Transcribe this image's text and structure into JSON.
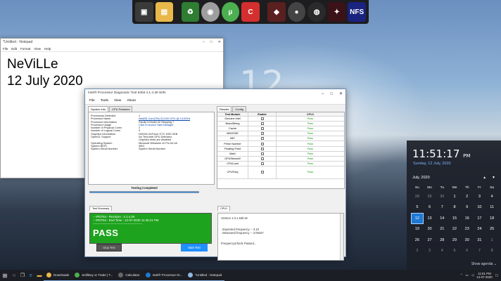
{
  "notepad": {
    "title": "*Untitled - Notepad",
    "menu": [
      "File",
      "Edit",
      "Format",
      "View",
      "Help"
    ],
    "lines": [
      "NeViLLe",
      "12 July 2020"
    ]
  },
  "desktop": {
    "ghost_text": "12"
  },
  "diagnostic": {
    "title": "Intel® Processor Diagnostic Tool 64bit 4.1.4.36 WIN",
    "menu": [
      "File",
      "Tools",
      "View",
      "About"
    ],
    "tabs": [
      "System Info",
      "CPU Features"
    ],
    "system_info": [
      {
        "k": "Processors Detected",
        "v": "1"
      },
      {
        "k": "Processor Name",
        "v": "Intel(R) Core(TM) i3-2100 CPU @ 3.10GHz",
        "link": true
      },
      {
        "k": "Processor Information",
        "v": "Family 6 Model 42 Stepping 7"
      },
      {
        "k": "Processor Usage",
        "v": "Click to launch Task Manager",
        "link": true
      },
      {
        "k": "Number of Physical Cores",
        "v": "2"
      },
      {
        "k": "Number of Logical Cores",
        "v": "4"
      },
      {
        "k": "Graphics Information",
        "v": "NVIDIA GeForce GTX 1050 3GB"
      },
      {
        "k": "OpenGL Support",
        "v": "No Test-Intel GPU Detected"
      },
      {
        "k": "",
        "v": "Graphics tests are disabled"
      },
      {
        "k": "Operating System",
        "v": "Microsoft Windows 10 Pro 64-bit"
      },
      {
        "k": "System BIOS",
        "v": "4601"
      },
      {
        "k": "System Serial Number",
        "v": "System Serial Number"
      }
    ],
    "results_tabs": [
      "Results",
      "Config"
    ],
    "results_header": {
      "module": "Test Module",
      "enable": "Enable",
      "cpu": "CPU1"
    },
    "results": [
      {
        "module": "Genuine Intel",
        "cpu": "Pass"
      },
      {
        "module": "BrandString",
        "cpu": "Pass"
      },
      {
        "module": "Cache",
        "cpu": "Pass"
      },
      {
        "module": "MMXSSE",
        "cpu": "Pass"
      },
      {
        "module": "IMC",
        "cpu": "Pass"
      },
      {
        "module": "Prime Number",
        "cpu": "Pass"
      },
      {
        "module": "Floating Point",
        "cpu": "Pass"
      },
      {
        "module": "Math",
        "cpu": "Pass"
      },
      {
        "module": "GPUStressW",
        "cpu": "Pass"
      },
      {
        "module": "CPULoad",
        "cpu": "Pass"
      },
      {
        "module": "CPUFreq",
        "cpu": "Pass",
        "tall": true
      }
    ],
    "status": "Testing Completed",
    "progress": 1.0,
    "summary_tab": "Test Summary",
    "summary_lines": [
      "-- IPDT64 - Revision : 4.1.4.36",
      "-- IPDT64 - End Time : 12-07-2020 11:45:21 PM",
      "------------------------------------------------"
    ],
    "summary_result": "PASS",
    "cpu_tab": "CPU1",
    "cpu_log": [
      "Version 1.0.1.64b.W",
      "",
      "",
      "..Expected Frequency -- 3.10",
      "..Measured frequency -- 3.09167",
      "",
      "",
      "FrequencyCheck Passed..."
    ],
    "stop_label": "Stop Test",
    "start_label": "Start Test"
  },
  "calendar": {
    "time": "11:51:17",
    "ampm": "PM",
    "date": "Sunday, 12 July, 2020",
    "month": "July, 2020",
    "weekdays": [
      "Su",
      "Mo",
      "Tu",
      "We",
      "Th",
      "Fr",
      "Sa"
    ],
    "days": [
      {
        "d": "28",
        "dim": true
      },
      {
        "d": "29",
        "dim": true
      },
      {
        "d": "30",
        "dim": true
      },
      {
        "d": "1"
      },
      {
        "d": "2"
      },
      {
        "d": "3"
      },
      {
        "d": "4"
      },
      {
        "d": "5"
      },
      {
        "d": "6"
      },
      {
        "d": "7"
      },
      {
        "d": "8"
      },
      {
        "d": "9"
      },
      {
        "d": "10"
      },
      {
        "d": "11"
      },
      {
        "d": "12",
        "today": true
      },
      {
        "d": "13"
      },
      {
        "d": "14"
      },
      {
        "d": "15"
      },
      {
        "d": "16"
      },
      {
        "d": "17"
      },
      {
        "d": "18"
      },
      {
        "d": "19"
      },
      {
        "d": "20"
      },
      {
        "d": "21"
      },
      {
        "d": "22"
      },
      {
        "d": "23"
      },
      {
        "d": "24"
      },
      {
        "d": "25"
      },
      {
        "d": "26"
      },
      {
        "d": "27"
      },
      {
        "d": "28"
      },
      {
        "d": "29"
      },
      {
        "d": "30"
      },
      {
        "d": "31"
      },
      {
        "d": "1",
        "dim": true
      },
      {
        "d": "2",
        "dim": true
      },
      {
        "d": "3",
        "dim": true
      },
      {
        "d": "4",
        "dim": true
      },
      {
        "d": "5",
        "dim": true
      },
      {
        "d": "6",
        "dim": true
      },
      {
        "d": "7",
        "dim": true
      },
      {
        "d": "8",
        "dim": true
      }
    ],
    "show_agenda": "Show agenda ⌄"
  },
  "taskbar": {
    "apps": [
      {
        "label": "Downloads",
        "color": "#e8b84a"
      },
      {
        "label": "Sell/Buy or Trade | T...",
        "color": "#4caf50"
      },
      {
        "label": "Calculator",
        "color": "#666666"
      },
      {
        "label": "Intel® Processor Di...",
        "color": "#1e78d2"
      },
      {
        "label": "*Untitled - Notepad",
        "color": "#8fb7e0"
      }
    ],
    "tray_time": "11:51 PM",
    "tray_date": "12-07-2020"
  },
  "colors": {
    "pass_green": "#1da31d",
    "accent_blue": "#1e90ff",
    "today_blue": "#1e78d2"
  }
}
